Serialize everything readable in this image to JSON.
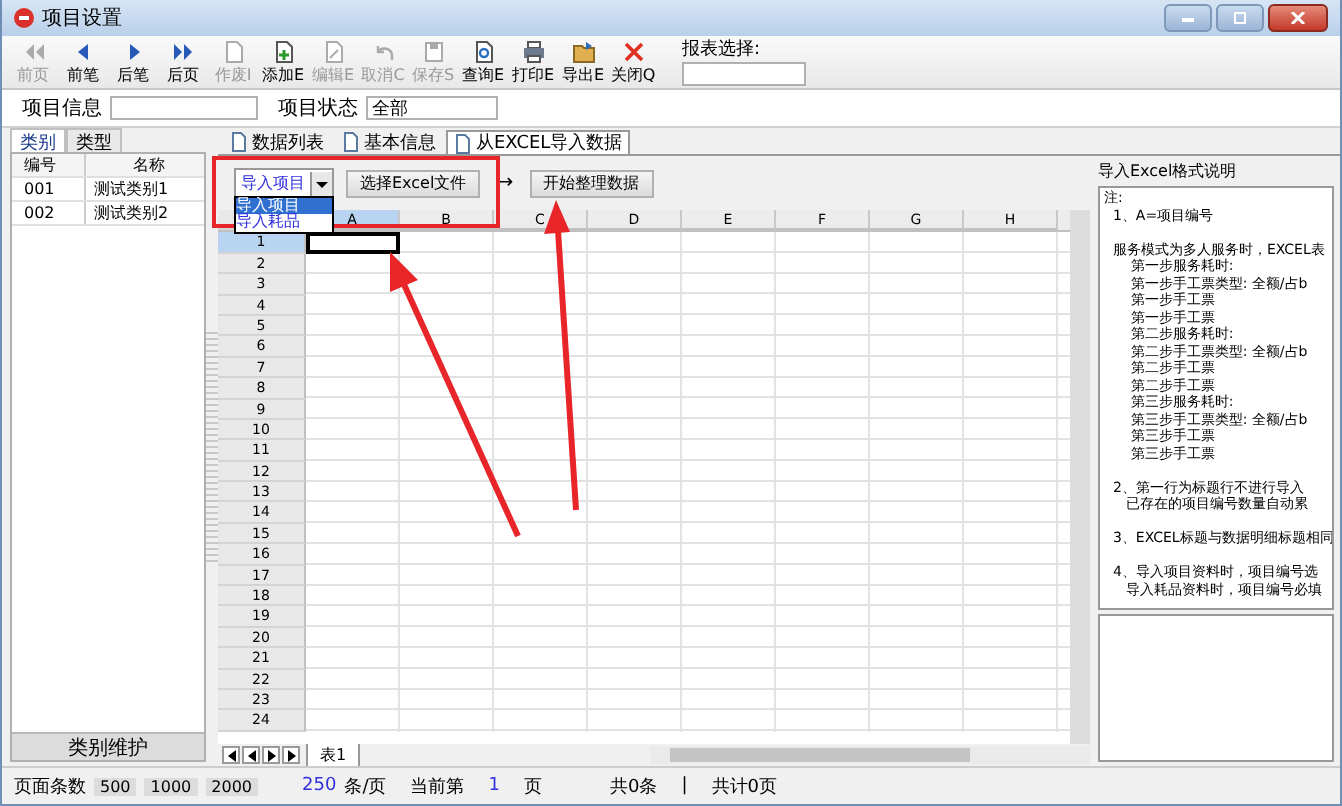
{
  "window": {
    "title": "项目设置"
  },
  "toolbar": [
    {
      "label": "前页",
      "disabled": true
    },
    {
      "label": "前笔",
      "disabled": false
    },
    {
      "label": "后笔",
      "disabled": false
    },
    {
      "label": "后页",
      "disabled": false
    },
    {
      "label": "作废I",
      "disabled": true
    },
    {
      "label": "添加E",
      "disabled": false
    },
    {
      "label": "编辑E",
      "disabled": true
    },
    {
      "label": "取消C",
      "disabled": true
    },
    {
      "label": "保存S",
      "disabled": true
    },
    {
      "label": "查询E",
      "disabled": false
    },
    {
      "label": "打印E",
      "disabled": false
    },
    {
      "label": "导出E",
      "disabled": false
    },
    {
      "label": "关闭Q",
      "disabled": false
    }
  ],
  "report_select": {
    "label": "报表选择:"
  },
  "filters": {
    "info_label": "项目信息",
    "status_label": "项目状态",
    "status_value": "全部"
  },
  "left_panel": {
    "tabs": [
      {
        "label": "类别",
        "selected": true
      },
      {
        "label": "类型",
        "selected": false
      }
    ],
    "columns": [
      "编号",
      "名称"
    ],
    "rows": [
      {
        "code": "001",
        "name": "测试类别1"
      },
      {
        "code": "002",
        "name": "测试类别2"
      }
    ],
    "maintain_button": "类别维护"
  },
  "main_tabs": [
    {
      "label": "数据列表",
      "selected": false
    },
    {
      "label": "基本信息",
      "selected": false
    },
    {
      "label": "从EXCEL导入数据",
      "selected": true
    }
  ],
  "import_bar": {
    "dropdown_value": "导入项目",
    "options": [
      {
        "label": "导入项目",
        "selected": true
      },
      {
        "label": "导入耗品",
        "selected": false
      }
    ],
    "choose_button": "选择Excel文件",
    "arrow": "→",
    "start_button": "开始整理数据"
  },
  "sheet": {
    "columns": [
      "A",
      "B",
      "C",
      "D",
      "E",
      "F",
      "G",
      "H"
    ],
    "rows": [
      "1",
      "2",
      "3",
      "4",
      "5",
      "6",
      "7",
      "8",
      "9",
      "10",
      "11",
      "12",
      "13",
      "14",
      "15",
      "16",
      "17",
      "18",
      "19",
      "20",
      "21",
      "22",
      "23",
      "24"
    ],
    "tab": "表1"
  },
  "notes": {
    "title": "导入Excel格式说明",
    "lines": [
      {
        "text": "注:",
        "gap_before": false
      },
      {
        "text": "  1、A=项目编号",
        "gap_before": false
      },
      {
        "text": "  服务模式为多人服务时，EXCEL表",
        "gap_before": true
      },
      {
        "text": "      第一步服务耗时:",
        "gap_before": false
      },
      {
        "text": "      第一步手工票类型: 全额/占b",
        "gap_before": false
      },
      {
        "text": "      第一步手工票",
        "gap_before": false
      },
      {
        "text": "      第一步手工票",
        "gap_before": false
      },
      {
        "text": "      第二步服务耗时:",
        "gap_before": false
      },
      {
        "text": "      第二步手工票类型: 全额/占b",
        "gap_before": false
      },
      {
        "text": "      第二步手工票",
        "gap_before": false
      },
      {
        "text": "      第二步手工票",
        "gap_before": false
      },
      {
        "text": "      第三步服务耗时:",
        "gap_before": false
      },
      {
        "text": "      第三步手工票类型: 全额/占b",
        "gap_before": false
      },
      {
        "text": "      第三步手工票",
        "gap_before": false
      },
      {
        "text": "      第三步手工票",
        "gap_before": false
      },
      {
        "text": "  2、第一行为标题行不进行导入",
        "gap_before": true
      },
      {
        "text": "     已存在的项目编号数量自动累",
        "gap_before": false
      },
      {
        "text": "  3、EXCEL标题与数据明细标题相同",
        "gap_before": true
      },
      {
        "text": "  4、导入项目资料时，项目编号选",
        "gap_before": true
      },
      {
        "text": "     导入耗品资料时，项目编号必填",
        "gap_before": false
      }
    ]
  },
  "status_bar": {
    "page_size_label": "页面条数",
    "sizes": [
      "500",
      "1000",
      "2000"
    ],
    "per_page": "250",
    "per_page_unit": "条/页",
    "current_label": "当前第",
    "current_page": "1",
    "page_unit": "页",
    "total": "共0条",
    "separator": "|",
    "total_pages": "共计0页"
  }
}
